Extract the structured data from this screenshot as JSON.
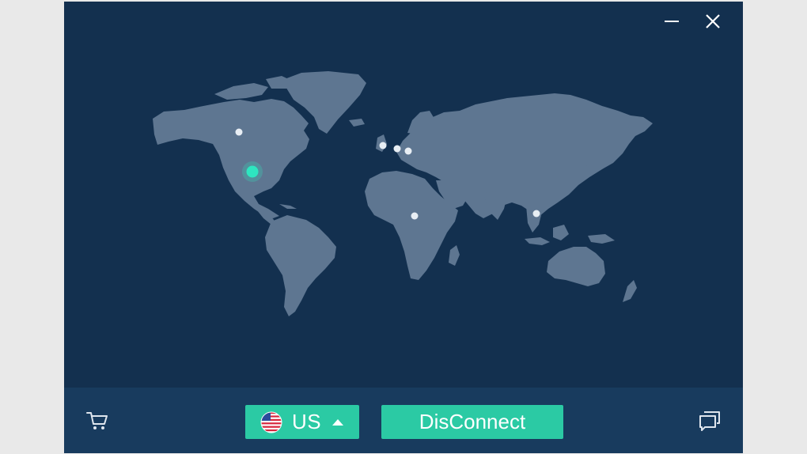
{
  "window": {
    "minimize_icon": "minimize-icon",
    "close_icon": "close-icon"
  },
  "map": {
    "land_color": "#5e7691",
    "background_color": "#13304f",
    "server_dot_color": "#e8eef4",
    "active_dot_color": "#2ee6c0"
  },
  "bottom_bar": {
    "cart_icon": "cart-icon",
    "region": {
      "flag_icon": "us-flag-icon",
      "label": "US",
      "caret_icon": "caret-up-icon"
    },
    "connect_button_label": "DisConnect",
    "chat_icon": "chat-icon",
    "accent_color": "#2bcaa4"
  }
}
